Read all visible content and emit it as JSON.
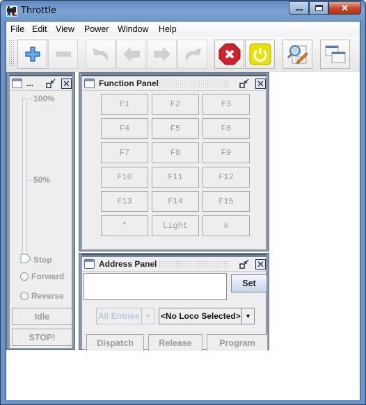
{
  "window": {
    "title": "Throttle",
    "minimize_glyph": "–",
    "maximize_glyph": "□",
    "close_glyph": "✕"
  },
  "menubar": [
    "File",
    "Edit",
    "View",
    "Power",
    "Window",
    "Help"
  ],
  "toolbar": {
    "buttons": [
      {
        "name": "add-throttle",
        "icon": "plus-icon",
        "enabled": true
      },
      {
        "name": "remove-throttle",
        "icon": "minus-icon",
        "enabled": false
      },
      {
        "name": "undo",
        "icon": "undo-arrow-icon",
        "enabled": false
      },
      {
        "name": "previous",
        "icon": "left-arrow-icon",
        "enabled": false
      },
      {
        "name": "next",
        "icon": "right-arrow-icon",
        "enabled": false
      },
      {
        "name": "redo",
        "icon": "redo-arrow-icon",
        "enabled": false
      },
      {
        "name": "emergency-stop",
        "icon": "stop-octagon-icon",
        "enabled": true
      },
      {
        "name": "power",
        "icon": "power-icon",
        "enabled": true
      },
      {
        "name": "preferences",
        "icon": "magnify-pencil-icon",
        "enabled": true
      },
      {
        "name": "windows",
        "icon": "windows-icon",
        "enabled": true
      }
    ],
    "colors": {
      "stop": "#d0222a",
      "power": "#e8e200",
      "plus": "#3d82c8"
    }
  },
  "control_panel": {
    "title": "...",
    "slider_labels": [
      "100%",
      "50%",
      "Stop"
    ],
    "speed_value": 0,
    "direction": {
      "forward": "Forward",
      "reverse": "Reverse"
    },
    "idle_label": "Idle",
    "stop_label": "STOP!"
  },
  "function_panel": {
    "title": "Function Panel",
    "buttons": [
      "F1",
      "F2",
      "F3",
      "F4",
      "F5",
      "F6",
      "F7",
      "F8",
      "F9",
      "F10",
      "F11",
      "F12",
      "F13",
      "F14",
      "F15",
      "*",
      "Light",
      "#"
    ]
  },
  "address_panel": {
    "title": "Address Panel",
    "address_value": "",
    "set_label": "Set",
    "roster_filter": "All Entries",
    "loco_select": "<No Loco Selected>",
    "dispatch_label": "Dispatch",
    "release_label": "Release",
    "program_label": "Program"
  }
}
